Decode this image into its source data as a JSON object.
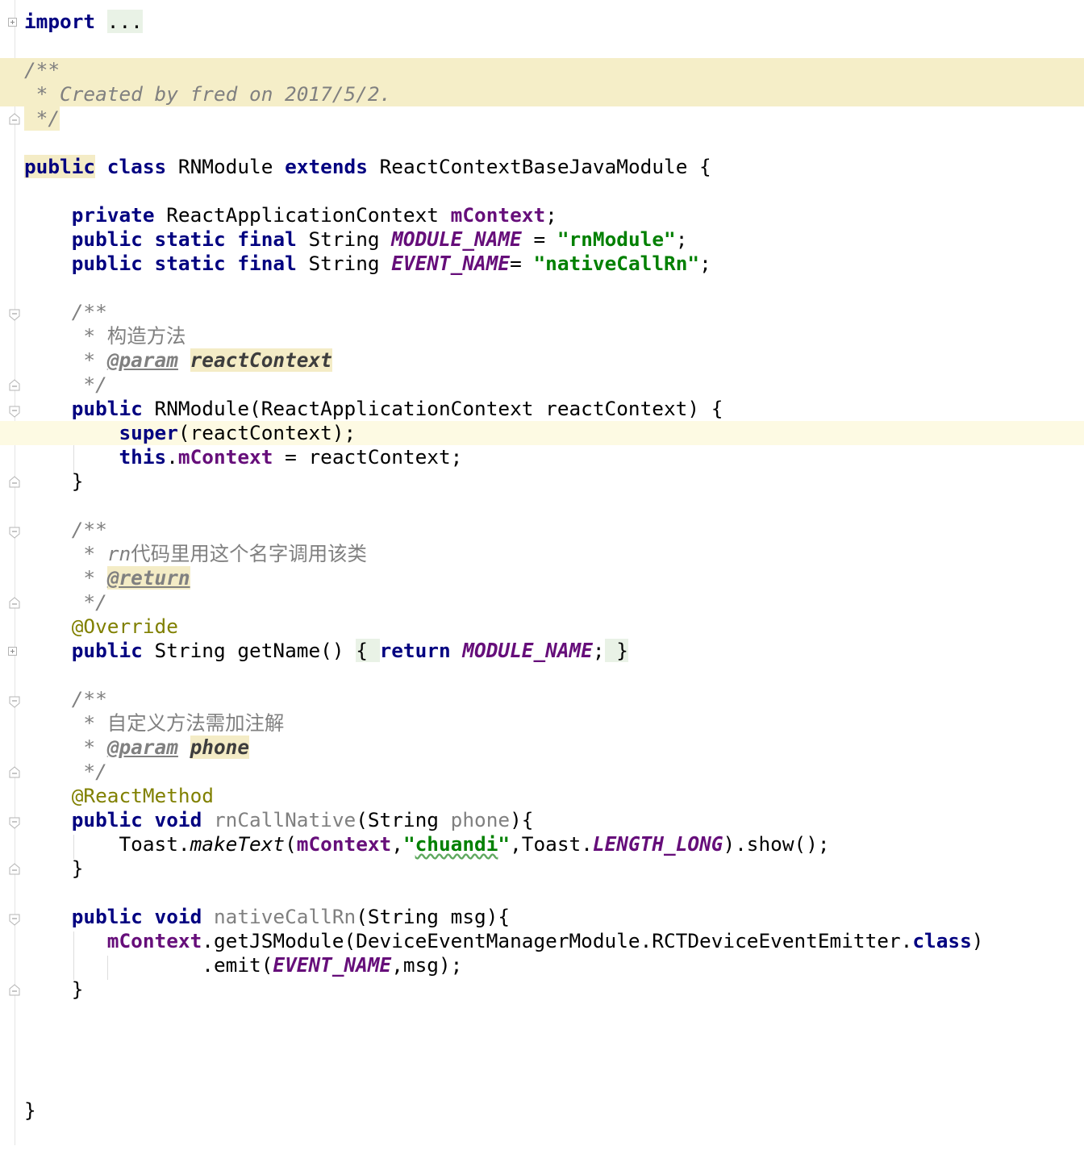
{
  "editor": {
    "language": "Java",
    "colors": {
      "keyword": "#000080",
      "field": "#660e7a",
      "string": "#008000",
      "comment": "#808080",
      "annotation": "#808000",
      "doc_comment_bg": "#f5eec8",
      "caret_line_bg": "#fdfae3"
    },
    "lines": {
      "import_kw": "import",
      "import_fold": "...",
      "header_doc_open": "/**",
      "header_doc_text": " * Created by fred on 2017/5/2.",
      "header_doc_close": " */",
      "class_public": "public",
      "class_kw": "class",
      "class_name": "RNModule",
      "class_extends": "extends",
      "class_super": "ReactContextBaseJavaModule {",
      "f1_mod": "private",
      "f1_type": "ReactApplicationContext",
      "f1_name": "mContext",
      "f1_end": ";",
      "f2_mods": "public static final",
      "f2_type": "String",
      "f2_name": "MODULE_NAME",
      "f2_eq": " = ",
      "f2_val": "\"rnModule\"",
      "f2_end": ";",
      "f3_mods": "public static final",
      "f3_type": "String",
      "f3_name": "EVENT_NAME",
      "f3_eq": "= ",
      "f3_val": "\"nativeCallRn\"",
      "f3_end": ";",
      "d1_open": "/**",
      "d1_text": " * 构造方法",
      "d1_star": " * ",
      "d1_tag": "@param",
      "d1_param": "reactContext",
      "d1_close": " */",
      "ctor_public": "public",
      "ctor_sig": "RNModule(ReactApplicationContext reactContext) {",
      "ctor_super": "super",
      "ctor_super_args": "(reactContext);",
      "ctor_this": "this",
      "ctor_dot": ".",
      "ctor_field": "mContext",
      "ctor_assign": " = reactContext;",
      "close_brace": "}",
      "d2_open": "/**",
      "d2_star": " * ",
      "d2_rn": "rn",
      "d2_text": "代码里用这个名字调用该类",
      "d2_tag": "@return",
      "d2_close": " */",
      "override": "@Override",
      "gn_public": "public",
      "gn_sig": "String getName()",
      "gn_open": "{ ",
      "gn_return": "return",
      "gn_const": "MODULE_NAME",
      "gn_end": ";",
      "gn_close": " }",
      "d3_open": "/**",
      "d3_text": " * 自定义方法需加注解",
      "d3_star": " * ",
      "d3_tag": "@param",
      "d3_param": "phone",
      "d3_close": " */",
      "react_method": "@ReactMethod",
      "m1_mods": "public void",
      "m1_name": "rnCallNative",
      "m1_paren": "(String ",
      "m1_param": "phone",
      "m1_end": "){",
      "t_toast": "Toast.",
      "t_make": "makeText",
      "t_paren": "(",
      "t_ctx": "mContext",
      "t_comma": ",",
      "t_q1": "\"",
      "t_str": "chuandi",
      "t_q2": "\"",
      "t_toast2": ",Toast.",
      "t_len": "LENGTH_LONG",
      "t_show": ").show();",
      "m2_mods": "public void",
      "m2_name": "nativeCallRn",
      "m2_params": "(String msg){",
      "e_ctx": "mContext",
      "e_call": ".getJSModule(DeviceEventManagerModule.RCTDeviceEventEmitter.",
      "e_class": "class",
      "e_close": ")",
      "em_emit": ".emit(",
      "em_name": "EVENT_NAME",
      "em_end": ",msg);",
      "final_brace": "}"
    }
  }
}
